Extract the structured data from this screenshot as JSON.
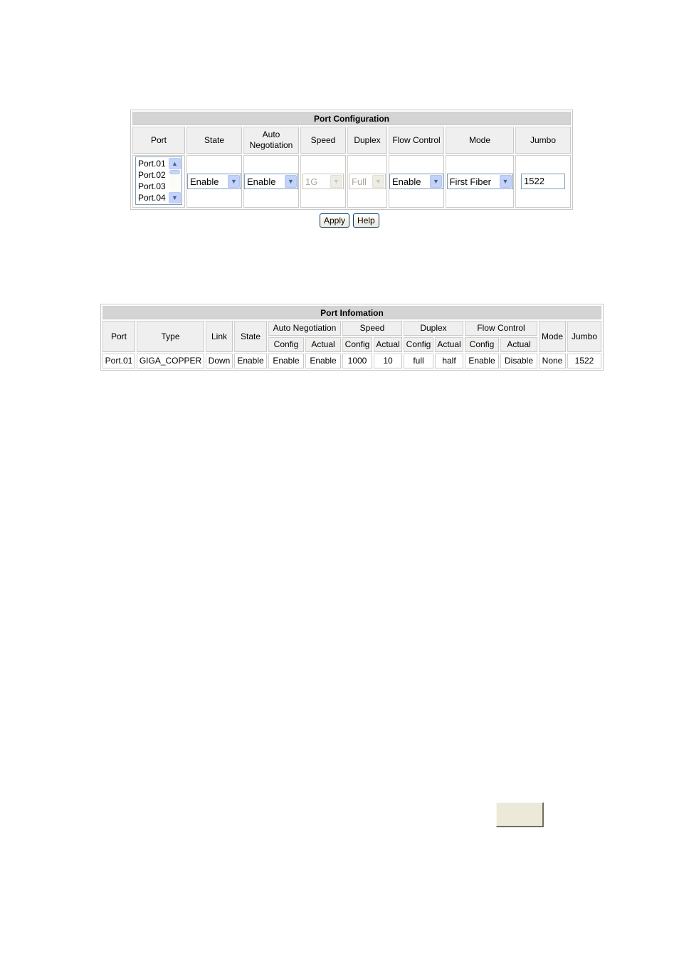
{
  "port_configuration": {
    "title": "Port Configuration",
    "headers": [
      "Port",
      "State",
      "Auto Negotiation",
      "Speed",
      "Duplex",
      "Flow Control",
      "Mode",
      "Jumbo"
    ],
    "port_list": [
      "Port.01",
      "Port.02",
      "Port.03",
      "Port.04"
    ],
    "state": "Enable",
    "auto_negotiation": "Enable",
    "speed": "1G",
    "duplex": "Full",
    "flow_control": "Enable",
    "mode": "First Fiber",
    "jumbo": "1522",
    "icons": {
      "scroll_up": "▲",
      "scroll_down": "▼",
      "dropdown": "▼"
    }
  },
  "buttons": {
    "apply": "Apply",
    "help": "Help"
  },
  "port_information": {
    "title": "Port Infomation",
    "headers_top": {
      "port": "Port",
      "type": "Type",
      "link": "Link",
      "state": "State",
      "auto_negotiation": "Auto Negotiation",
      "speed": "Speed",
      "duplex": "Duplex",
      "flow_control": "Flow Control",
      "mode": "Mode",
      "jumbo": "Jumbo"
    },
    "sub_headers": {
      "config": "Config",
      "actual": "Actual"
    },
    "row": {
      "port": "Port.01",
      "type": "GIGA_COPPER",
      "link": "Down",
      "state": "Enable",
      "an_config": "Enable",
      "an_actual": "Enable",
      "speed_config": "1000",
      "speed_actual": "10",
      "duplex_config": "full",
      "duplex_actual": "half",
      "fc_config": "Enable",
      "fc_actual": "Disable",
      "mode": "None",
      "jumbo": "1522"
    }
  }
}
